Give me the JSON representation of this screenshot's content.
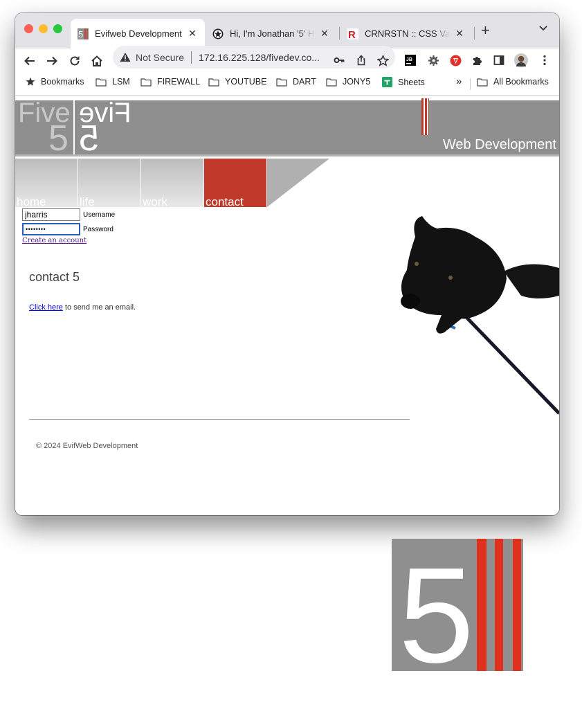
{
  "browser": {
    "tabs": [
      {
        "title": "Evifweb Development",
        "active": true
      },
      {
        "title": "Hi, I'm Jonathan '5' Harris",
        "active": false
      },
      {
        "title": "CRNRSTN :: CSS Validator",
        "active": false
      }
    ],
    "new_tab": "+",
    "address": {
      "security_label": "Not Secure",
      "url": "172.16.225.128/fivedev.co..."
    },
    "bookmarks": [
      {
        "label": "Bookmarks",
        "icon": "star-icon"
      },
      {
        "label": "LSM",
        "icon": "folder-icon"
      },
      {
        "label": "FIREWALL",
        "icon": "folder-icon"
      },
      {
        "label": "YOUTUBE",
        "icon": "folder-icon"
      },
      {
        "label": "DART",
        "icon": "folder-icon"
      },
      {
        "label": "JONY5",
        "icon": "folder-icon"
      },
      {
        "label": "Sheets",
        "icon": "sheets-icon"
      }
    ],
    "bookmarks_overflow": "»",
    "all_bookmarks": "All Bookmarks"
  },
  "site": {
    "logo": {
      "five": "Five",
      "evif": "Five",
      "digit": "5"
    },
    "tagline": "Web Development",
    "nav": [
      {
        "label": "home",
        "active": false
      },
      {
        "label": "life",
        "active": false
      },
      {
        "label": "work",
        "active": false
      },
      {
        "label": "contact",
        "active": true
      }
    ],
    "login": {
      "username_value": "jharris",
      "username_label": "Username",
      "password_value": "••••••••",
      "password_label": "Password",
      "create_account": "Create an account"
    },
    "heading": "contact 5",
    "email": {
      "link": "Click here",
      "text": " to send me an email."
    },
    "footer": "© 2024 EvifWeb Development"
  },
  "colors": {
    "accent_red": "#c0392b",
    "banner_gray": "#8f8f8f",
    "tab_strip": "#e3e3e7"
  }
}
